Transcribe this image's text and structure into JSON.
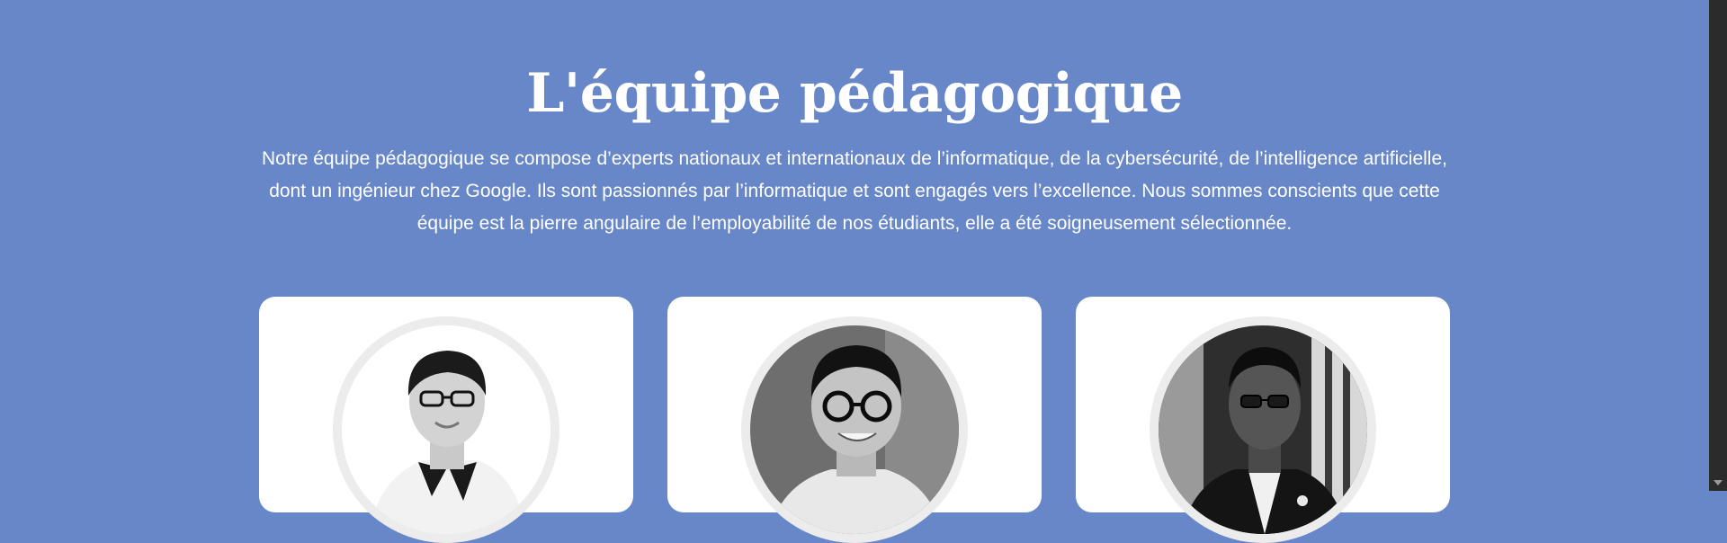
{
  "section": {
    "title": "L'équipe pédagogique",
    "intro": "Notre équipe pédagogique se compose d’experts nationaux et internationaux de l’informatique, de la cybersécurité, de l’intelligence artificielle, dont un ingénieur chez Google. Ils sont passionnés par l’informatique et sont engagés vers l’excellence. Nous sommes conscients que cette équipe est la pierre angulaire de l’employabilité de nos étudiants, elle a été soigneusement sélectionnée."
  },
  "team": [
    {
      "photo": "team-member-1-portrait"
    },
    {
      "photo": "team-member-2-portrait"
    },
    {
      "photo": "team-member-3-portrait"
    }
  ],
  "colors": {
    "background": "#6787c8",
    "card": "#ffffff",
    "text": "#ffffff"
  }
}
